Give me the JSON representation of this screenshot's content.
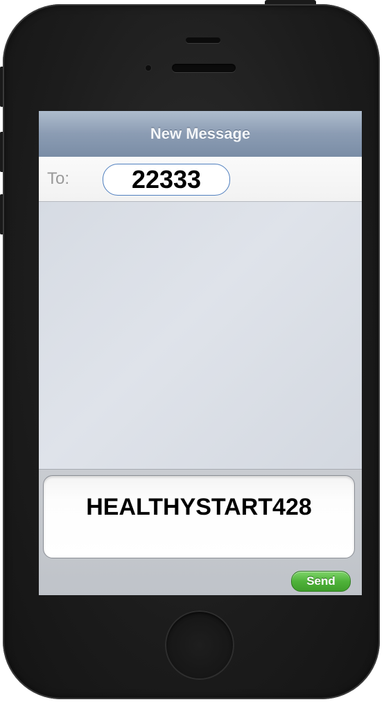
{
  "device": {
    "frame_color": "#1c1c1c",
    "accent_send_color": "#4fb33a"
  },
  "nav": {
    "title": "New Message"
  },
  "to_field": {
    "label": "To:",
    "recipient": "22333"
  },
  "compose": {
    "message_text": "HEALTHYSTART428",
    "send_label": "Send"
  },
  "icons": {
    "camera": "camera-icon",
    "speaker": "speaker-icon",
    "home": "home-button-icon"
  }
}
